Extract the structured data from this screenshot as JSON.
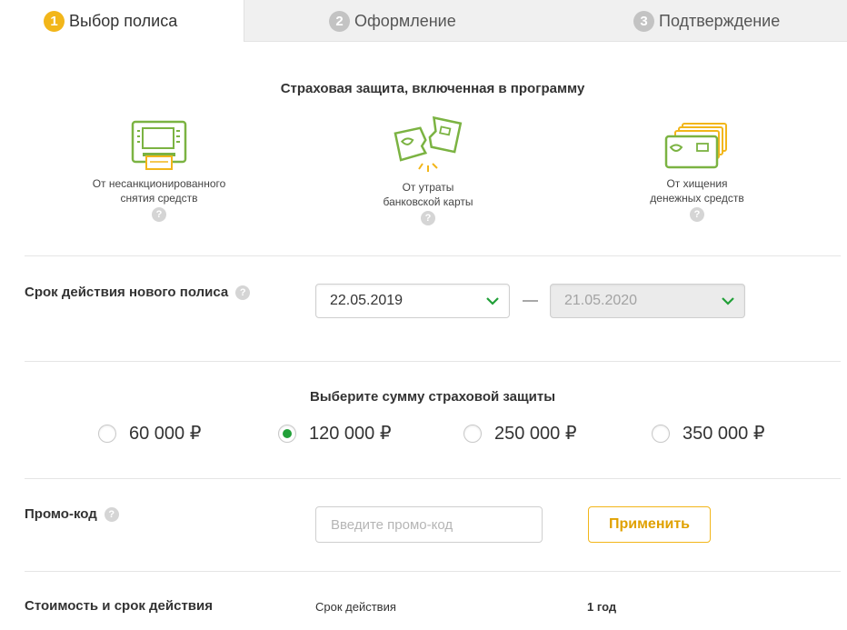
{
  "tabs": [
    {
      "num": "1",
      "label": "Выбор полиса"
    },
    {
      "num": "2",
      "label": "Оформление"
    },
    {
      "num": "3",
      "label": "Подтверждение"
    }
  ],
  "protection": {
    "title": "Страховая защита, включенная в программу",
    "features": [
      {
        "line1": "От несанкционированного",
        "line2": "снятия средств",
        "icon": "atm-icon"
      },
      {
        "line1": "От утраты",
        "line2": "банковской карты",
        "icon": "broken-card-icon"
      },
      {
        "line1": "От хищения",
        "line2": "денежных средств",
        "icon": "cards-stack-icon"
      }
    ],
    "help": "?"
  },
  "term": {
    "label": "Срок действия нового полиса",
    "start_date": "22.05.2019",
    "end_date": "21.05.2020"
  },
  "amount": {
    "title": "Выберите сумму страховой защиты",
    "options": [
      "60 000 ₽",
      "120 000 ₽",
      "250 000 ₽",
      "350 000 ₽"
    ],
    "selected_index": 1
  },
  "promo": {
    "label": "Промо-код",
    "placeholder": "Введите промо-код",
    "apply_label": "Применить"
  },
  "cost": {
    "label": "Стоимость и срок действия",
    "term_label": "Срок действия",
    "term_value": "1 год"
  },
  "colors": {
    "accent": "#f2b61a",
    "green": "#21a038",
    "icon_green": "#7bb342"
  }
}
